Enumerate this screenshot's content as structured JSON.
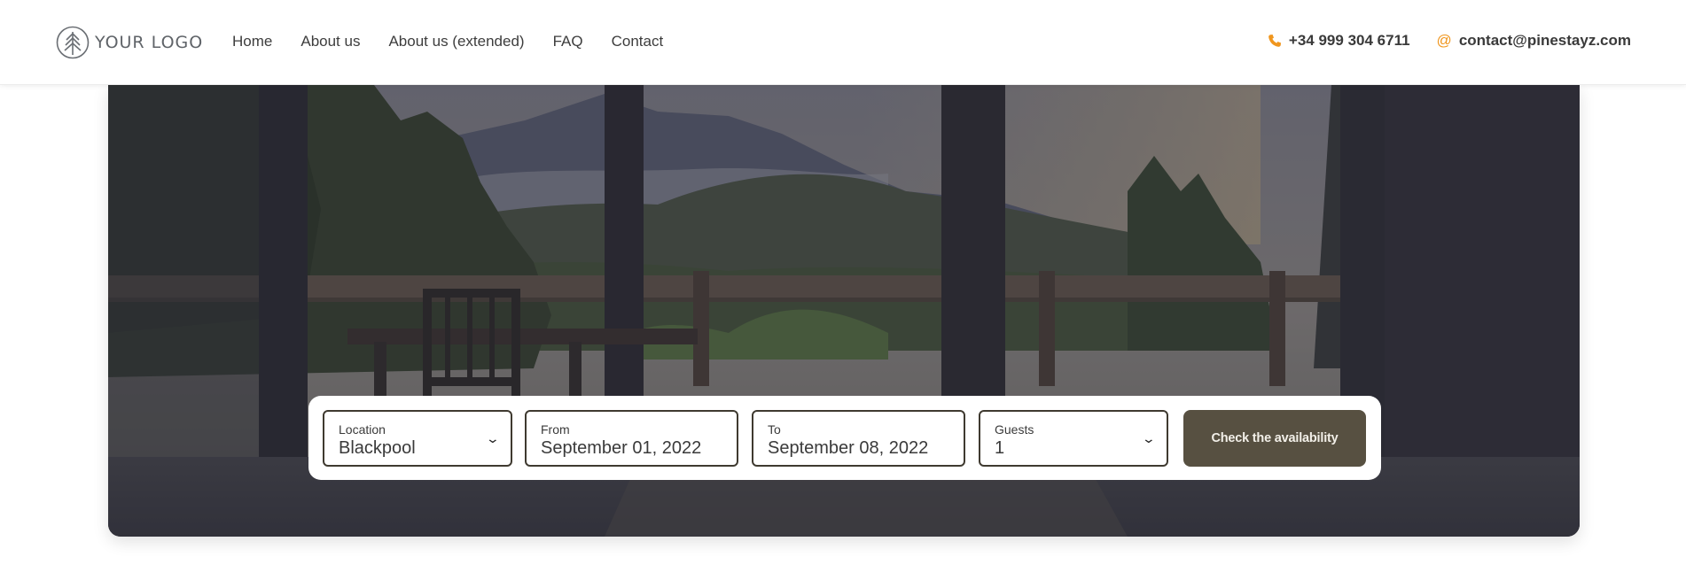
{
  "header": {
    "logo_text": "YOUR LOGO",
    "nav": [
      "Home",
      "About us",
      "About us (extended)",
      "FAQ",
      "Contact"
    ],
    "phone": "+34 999 304 6711",
    "email": "contact@pinestayz.com",
    "phone_icon": "phone-icon",
    "email_icon": "at-sign-icon"
  },
  "booking": {
    "location": {
      "label": "Location",
      "value": "Blackpool"
    },
    "from": {
      "label": "From",
      "value": "September 01, 2022"
    },
    "to": {
      "label": "To",
      "value": "September 08, 2022"
    },
    "guests": {
      "label": "Guests",
      "value": "1"
    },
    "submit_label": "Check the availability"
  },
  "colors": {
    "accent": "#f0961e",
    "button": "#575041",
    "field_border": "#3f3a30"
  }
}
